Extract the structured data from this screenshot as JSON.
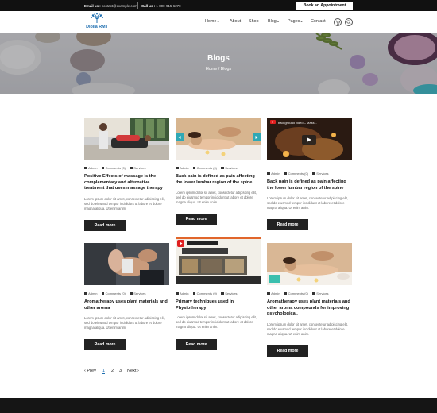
{
  "topbar": {
    "email_label": "Email us :",
    "email": "contact@example.com",
    "call_label": "Call us :",
    "phone": "1-800-915-6270",
    "appointment": "Book an Appointment"
  },
  "logo": {
    "brand": "Diolla RMT"
  },
  "nav": [
    "Home",
    "About",
    "Shop",
    "Blog",
    "Pages",
    "Contact"
  ],
  "hero": {
    "title": "Blogs",
    "breadcrumb": "Home / Blogs"
  },
  "posts": [
    {
      "author": "Admin",
      "comments": "Comments (0)",
      "category": "Services",
      "title": "Positive Effects of massage is the complementary and alternative treatment that uses massage therapy",
      "excerpt": "Lorem ipsum dolor sit amet, consectetur adipiscing elit, sed do eiusmod tempor incididunt ut labore et dolore magna aliqua. Ut enim anim.",
      "button": "Read more"
    },
    {
      "author": "Admin",
      "comments": "Comments (0)",
      "category": "Services",
      "title": "Back pain is defined as pain affecting the lower lumbar region of the spine",
      "excerpt": "Lorem ipsum dolor sit amet, consectetur adipiscing elit, sed do eiusmod tempor incididunt ut labore et dolore magna aliqua. Ut enim anim.",
      "button": "Read more"
    },
    {
      "author": "Admin",
      "comments": "Comments (0)",
      "category": "Services",
      "title": "Back pain is defined as pain affecting the lower lumbar region of the spine",
      "excerpt": "Lorem ipsum dolor sit amet, consectetur adipiscing elit, sed do eiusmod tempor incididunt ut labore et dolore magna aliqua. Ut enim anim.",
      "button": "Read more",
      "video_label": "background video – Mass..."
    },
    {
      "author": "Admin",
      "comments": "Comments (0)",
      "category": "Services",
      "title": "Aromatherapy uses plant materials and other aroma",
      "excerpt": "Lorem ipsum dolor sit amet, consectetur adipiscing elit, sed do eiusmod tempor incididunt ut labore et dolore magna aliqua. Ut enim anim.",
      "button": "Read more"
    },
    {
      "author": "Admin",
      "comments": "Comments (0)",
      "category": "Services",
      "title": "Primary techniques used in Physiotherapy",
      "excerpt": "Lorem ipsum dolor sit amet, consectetur adipiscing elit, sed do eiusmod tempor incididunt ut labore et dolore magna aliqua. Ut enim anim.",
      "button": "Read more"
    },
    {
      "author": "Admin",
      "comments": "Comments (0)",
      "category": "Services",
      "title": "Aromatherapy uses plant materials and other aroma compounds for improving psychological.",
      "excerpt": "Lorem ipsum dolor sit amet, consectetur adipiscing elit, sed do eiusmod tempor incididunt ut labore et dolore magna aliqua. Ut enim anim.",
      "button": "Read more"
    }
  ],
  "pager": {
    "prev": "‹ Prev",
    "pages": [
      "1",
      "2",
      "3"
    ],
    "next": "Next ›"
  },
  "colors": {
    "accent": "#1f6fb0",
    "dark": "#222222"
  }
}
